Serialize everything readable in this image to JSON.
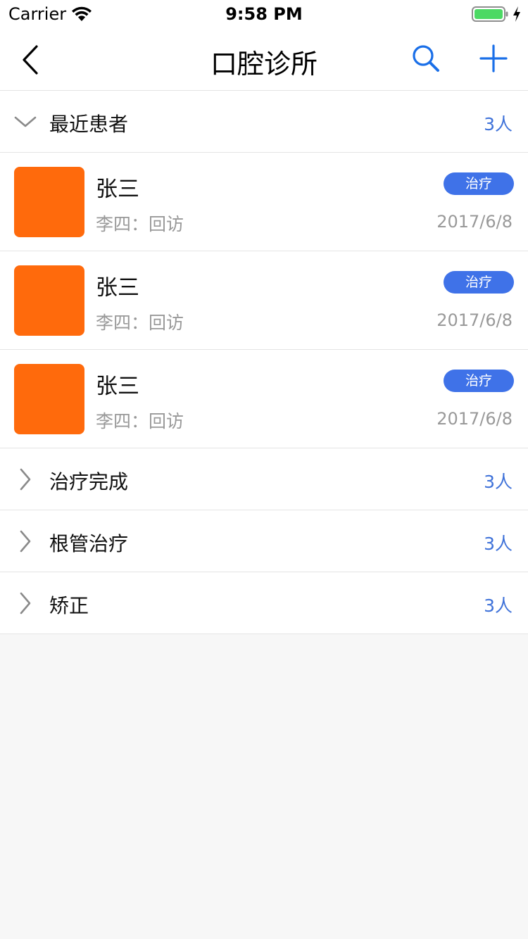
{
  "status_bar": {
    "carrier": "Carrier",
    "time": "9:58 PM",
    "battery_color": "#4cd964"
  },
  "nav": {
    "title": "口腔诊所",
    "accent_color": "#1a6fe8",
    "icons": [
      "back-chevron-icon",
      "search-icon",
      "plus-icon"
    ]
  },
  "groups": [
    {
      "title": "最近患者",
      "count": "3人",
      "expanded": true,
      "patients": [
        {
          "name": "张三",
          "sub": "李四：回访",
          "badge": "治疗",
          "date": "2017/6/8"
        },
        {
          "name": "张三",
          "sub": "李四：回访",
          "badge": "治疗",
          "date": "2017/6/8"
        },
        {
          "name": "张三",
          "sub": "李四：回访",
          "badge": "治疗",
          "date": "2017/6/8"
        }
      ]
    },
    {
      "title": "治疗完成",
      "count": "3人",
      "expanded": false
    },
    {
      "title": "根管治疗",
      "count": "3人",
      "expanded": false
    },
    {
      "title": "矫正",
      "count": "3人",
      "expanded": false
    }
  ],
  "colors": {
    "avatar": "#ff6a0c",
    "badge": "#3f72e8",
    "count_text": "#3f72d9"
  }
}
